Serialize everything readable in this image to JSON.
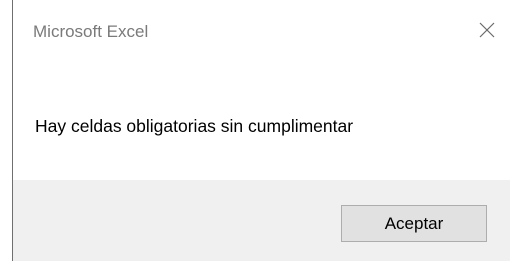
{
  "dialog": {
    "title": "Microsoft Excel",
    "message": "Hay celdas obligatorias sin cumplimentar",
    "close_icon": "close-icon",
    "ok_label": "Aceptar"
  }
}
